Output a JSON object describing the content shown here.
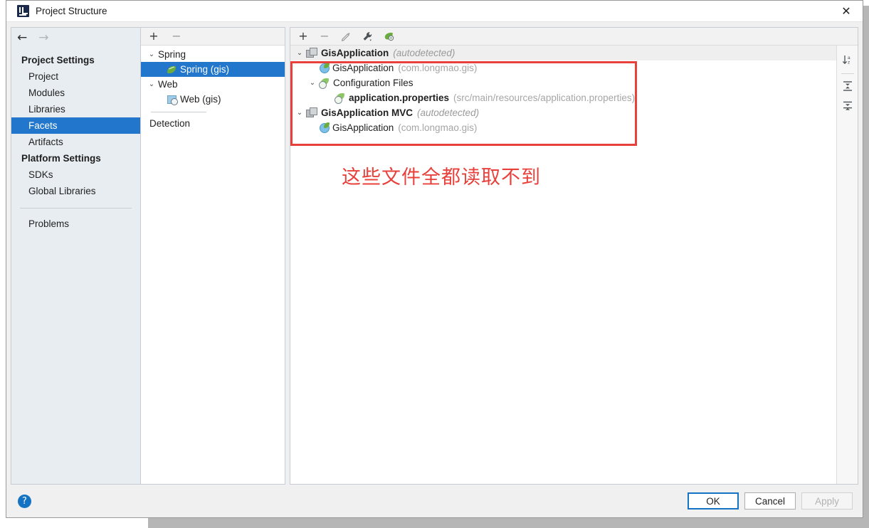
{
  "window": {
    "title": "Project Structure",
    "logo_icon": "intellij-idea-logo",
    "close_icon": "close-icon"
  },
  "nav": {
    "back_icon": "arrow-left-icon",
    "forward_icon": "arrow-right-icon"
  },
  "sidebar": {
    "groups": [
      {
        "label": "Project Settings",
        "items": [
          {
            "label": "Project",
            "selected": false
          },
          {
            "label": "Modules",
            "selected": false
          },
          {
            "label": "Libraries",
            "selected": false
          },
          {
            "label": "Facets",
            "selected": true
          },
          {
            "label": "Artifacts",
            "selected": false
          }
        ]
      },
      {
        "label": "Platform Settings",
        "items": [
          {
            "label": "SDKs",
            "selected": false
          },
          {
            "label": "Global Libraries",
            "selected": false
          }
        ]
      }
    ],
    "problems_label": "Problems"
  },
  "middle_panel": {
    "toolbar": [
      {
        "icon": "plus-icon",
        "label": "+",
        "enabled": true
      },
      {
        "icon": "minus-icon",
        "label": "−",
        "enabled": false
      }
    ],
    "tree": [
      {
        "label": "Spring",
        "icon": null,
        "twisty": "⌄",
        "indent": 1,
        "selected": false
      },
      {
        "label": "Spring (gis)",
        "icon": "spring-leaf-icon",
        "twisty": "",
        "indent": 2,
        "selected": true
      },
      {
        "label": "Web",
        "icon": null,
        "twisty": "⌄",
        "indent": 1,
        "selected": false
      },
      {
        "label": "Web (gis)",
        "icon": "web-facet-icon",
        "twisty": "",
        "indent": 2,
        "selected": false
      }
    ],
    "detection_label": "Detection"
  },
  "right_panel": {
    "toolbar": [
      {
        "icon": "plus-icon",
        "label": "+",
        "enabled": true
      },
      {
        "icon": "minus-icon",
        "label": "−",
        "enabled": false
      },
      {
        "icon": "edit-pencil-icon",
        "label": "✎",
        "enabled": false
      },
      {
        "icon": "wrench-icon",
        "label": "🔧",
        "enabled": true
      },
      {
        "icon": "spring-leaf-icon",
        "label": "",
        "enabled": true
      }
    ],
    "side_tools": [
      {
        "icon": "sort-alphabetically-icon",
        "label": "↓"
      },
      {
        "icon": "expand-all-icon",
        "label": ""
      },
      {
        "icon": "collapse-all-icon",
        "label": ""
      }
    ],
    "tree": [
      {
        "twisty": "⌄",
        "icon": "facet-module-icon",
        "name": "GisApplication",
        "bold": true,
        "meta": "(autodetected)",
        "path": "",
        "indent": 0,
        "header": true
      },
      {
        "twisty": "",
        "icon": "spring-bean-icon",
        "name": "GisApplication",
        "bold": false,
        "meta": "",
        "path": "(com.longmao.gis)",
        "indent": 2,
        "header": false
      },
      {
        "twisty": "⌄",
        "icon": "config-files-icon",
        "name": "Configuration Files",
        "bold": false,
        "meta": "",
        "path": "",
        "indent": 1,
        "header": false
      },
      {
        "twisty": "",
        "icon": "properties-file-icon",
        "name": "application.properties",
        "bold": true,
        "meta": "",
        "path": "(src/main/resources/application.properties)",
        "indent": 3,
        "header": false
      },
      {
        "twisty": "⌄",
        "icon": "facet-module-icon",
        "name": "GisApplication MVC",
        "bold": true,
        "meta": "(autodetected)",
        "path": "",
        "indent": 0,
        "header": false
      },
      {
        "twisty": "",
        "icon": "spring-bean-icon",
        "name": "GisApplication",
        "bold": false,
        "meta": "",
        "path": "(com.longmao.gis)",
        "indent": 2,
        "header": false
      }
    ],
    "annotation": {
      "text": "这些文件全都读取不到",
      "color": "#e8403a"
    },
    "highlight_box_color": "#e8403a"
  },
  "footer": {
    "help_icon": "help-question-icon",
    "help_label": "?",
    "buttons": [
      {
        "label": "OK",
        "state": "default"
      },
      {
        "label": "Cancel",
        "state": "normal"
      },
      {
        "label": "Apply",
        "state": "disabled"
      }
    ]
  },
  "colors": {
    "selection_blue": "#2277cc",
    "annotation_red": "#e8403a",
    "sidebar_bg": "#e8edf1"
  }
}
